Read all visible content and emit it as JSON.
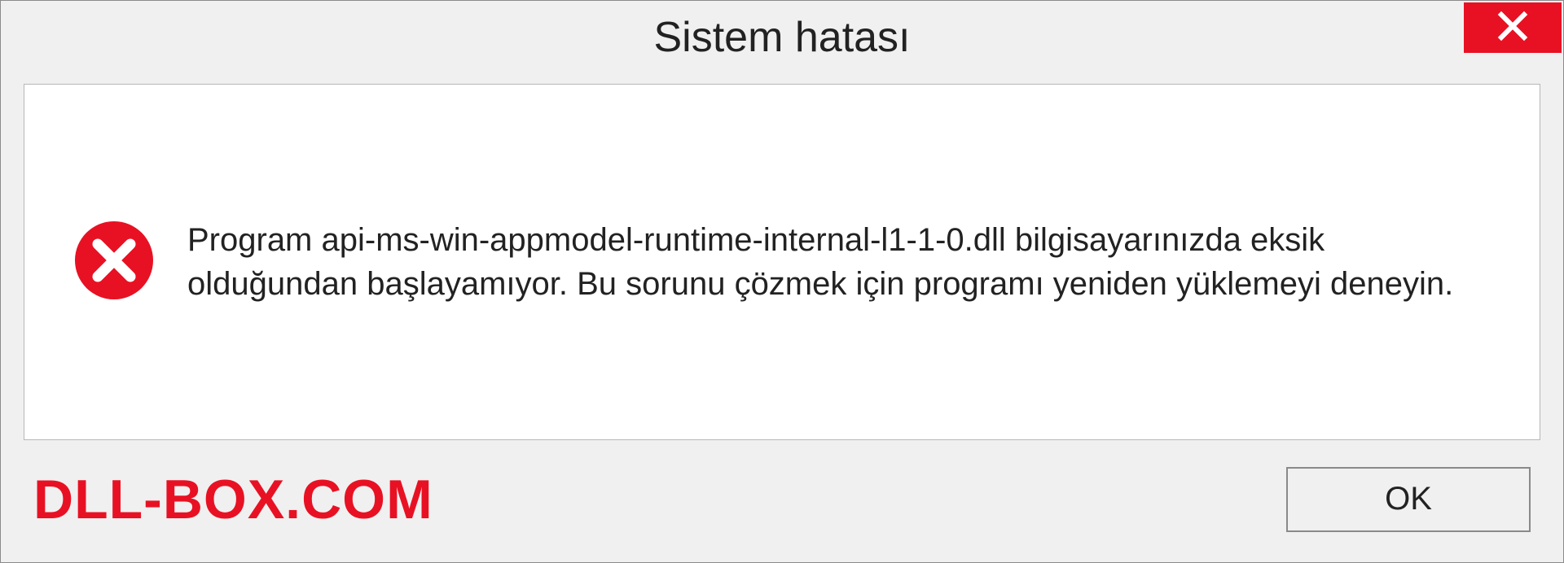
{
  "titlebar": {
    "title": "Sistem hatası"
  },
  "content": {
    "message": "Program api-ms-win-appmodel-runtime-internal-l1-1-0.dll bilgisayarınızda eksik olduğundan başlayamıyor. Bu sorunu çözmek için programı yeniden yüklemeyi deneyin."
  },
  "footer": {
    "watermark": "DLL-BOX.COM",
    "ok_label": "OK"
  },
  "colors": {
    "close_bg": "#e81123",
    "watermark": "#e81123"
  }
}
